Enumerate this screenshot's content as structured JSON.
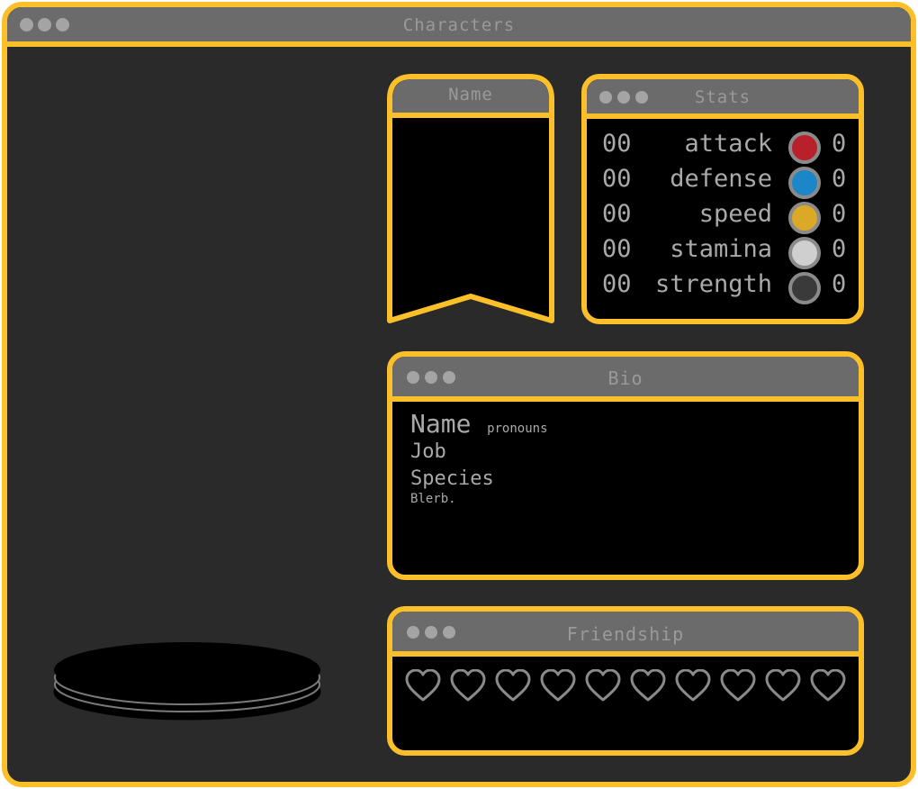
{
  "main_window": {
    "title": "Characters"
  },
  "name_panel": {
    "title": "Name"
  },
  "stats": {
    "title": "Stats",
    "rows": [
      {
        "num": "00",
        "label": "attack",
        "color": "#b8202a",
        "value": "0"
      },
      {
        "num": "00",
        "label": "defense",
        "color": "#1b87c9",
        "value": "0"
      },
      {
        "num": "00",
        "label": "speed",
        "color": "#dba827",
        "value": "0"
      },
      {
        "num": "00",
        "label": "stamina",
        "color": "#cfcfcf",
        "value": "0"
      },
      {
        "num": "00",
        "label": "strength",
        "color": "#3a3a3a",
        "value": "0"
      }
    ]
  },
  "bio": {
    "title": "Bio",
    "name": "Name",
    "pronouns": "pronouns",
    "job": "Job",
    "species": "Species",
    "blurb": "Blerb."
  },
  "friendship": {
    "title": "Friendship",
    "hearts_total": 10,
    "hearts_filled": 0
  },
  "colors": {
    "accent": "#fbbf2a",
    "titlebar": "#6b6b6b",
    "window_bg": "#2a2a2a",
    "panel_bg": "#000000",
    "text": "#a9a9a9"
  }
}
